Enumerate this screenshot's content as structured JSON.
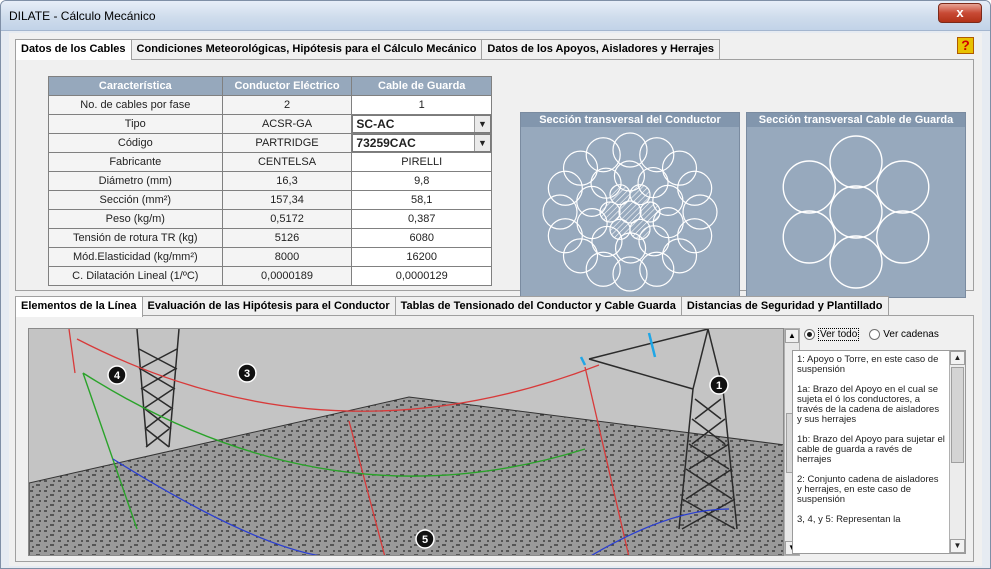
{
  "window": {
    "title": "DILATE - Cálculo Mecánico",
    "close_label": "x"
  },
  "tabs": [
    "Datos de los Cables",
    "Condiciones Meteorológicas, Hipótesis para el Cálculo Mecánico",
    "Datos de los Apoyos, Aisladores y Herrajes"
  ],
  "help_label": "?",
  "table": {
    "headers": [
      "Característica",
      "Conductor Eléctrico",
      "Cable de Guarda"
    ],
    "rows": [
      [
        "No. de cables por fase",
        "2",
        "1"
      ],
      [
        "Tipo",
        "ACSR-GA",
        "SC-AC"
      ],
      [
        "Código",
        "PARTRIDGE",
        "73259CAC"
      ],
      [
        "Fabricante",
        "CENTELSA",
        "PIRELLI"
      ],
      [
        "Diámetro (mm)",
        "16,3",
        "9,8"
      ],
      [
        "Sección (mm²)",
        "157,34",
        "58,1"
      ],
      [
        "Peso (kg/m)",
        "0,5172",
        "0,387"
      ],
      [
        "Tensión de rotura TR (kg)",
        "5126",
        "6080"
      ],
      [
        "Mód.Elasticidad (kg/mm²)",
        "8000",
        "16200"
      ],
      [
        "C. Dilatación Lineal (1/ºC)",
        "0,0000189",
        "0,0000129"
      ]
    ]
  },
  "sections": {
    "conductor_title": "Sección transversal del Conductor",
    "guard_title": "Sección transversal Cable de Guarda"
  },
  "bottom_tabs": [
    "Elementos de la Línea",
    "Evaluación de las Hipótesis para el Conductor",
    "Tablas de Tensionado del Conductor y Cable Guarda",
    "Distancias de Seguridad y Plantillado"
  ],
  "view": {
    "option_all": "Ver todo",
    "option_chains": "Ver cadenas",
    "markers": [
      "1",
      "3",
      "4",
      "5"
    ]
  },
  "legend": [
    "1: Apoyo o Torre, en este caso de suspensión",
    "1a: Brazo del Apoyo en el cual se sujeta el ó los conductores, a través de la cadena de aisladores y sus herrajes",
    "1b: Brazo del Apoyo para sujetar el cable de guarda a ravés de herrajes",
    "2: Conjunto cadena de aisladores y herrajes, en este caso de suspensión",
    "3, 4, y 5: Representan la"
  ],
  "colors": {
    "header_bg": "#96a8bc",
    "section_bg": "#97a9bd",
    "accent_red": "#d10000"
  }
}
